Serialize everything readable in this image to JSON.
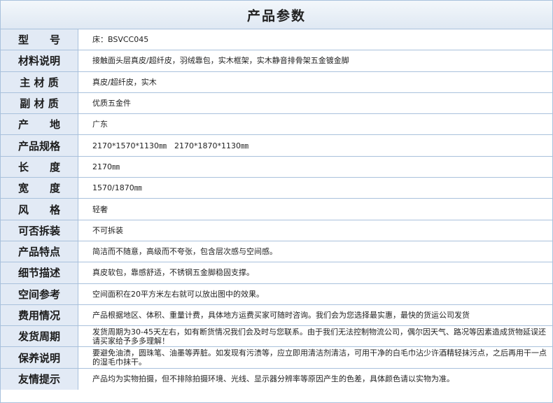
{
  "title": "产品参数",
  "rows": [
    {
      "label": "型　　号",
      "value": "床：BSVCC045"
    },
    {
      "label": "材料说明",
      "value": "接触面头层真皮/超纤皮，羽绒靠包，实木框架，实木静音排骨架五金镀金脚"
    },
    {
      "label": "主 材 质",
      "value": "真皮/超纤皮，实木"
    },
    {
      "label": "副 材 质",
      "value": "优质五金件"
    },
    {
      "label": "产　　地",
      "value": "广东"
    },
    {
      "label": "产品规格",
      "value": "2170*1570*1130㎜　2170*1870*1130㎜"
    },
    {
      "label": "长　　度",
      "value": "2170㎜"
    },
    {
      "label": "宽　　度",
      "value": "1570/1870㎜"
    },
    {
      "label": "风　　格",
      "value": "轻奢"
    },
    {
      "label": "可否拆装",
      "value": "不可拆装"
    },
    {
      "label": "产品特点",
      "value": "简洁而不随意，高级而不夸张，包含层次感与空间感。"
    },
    {
      "label": "细节描述",
      "value": "真皮软包，靠感舒适，不锈钢五金脚稳固支撑。"
    },
    {
      "label": "空间参考",
      "value": "空间面积在20平方米左右就可以放出图中的效果。"
    },
    {
      "label": "费用情况",
      "value": "产品根据地区、体积、重量计费，具体地方运费买家可随时咨询。我们会为您选择最实惠，最快的货运公司发货"
    },
    {
      "label": "发货周期",
      "value": "发货周期为30-45天左右，如有断货情况我们会及时与您联系。由于我们无法控制物流公司，偶尔因天气、路况等因素造成货物延误还请买家给予多多理解！"
    },
    {
      "label": "保养说明",
      "value": "要避免油渍，圆珠笔、油墨等弄脏。如发现有污渍等，应立即用清洁剂清洁，可用干净的白毛巾沾少许酒精轻抹污点，之后再用干一点的湿毛巾抹干。"
    },
    {
      "label": "友情提示",
      "value": "产品均为实物拍摄，但不排除拍摄环境、光线、显示器分辨率等原因产生的色差，具体颜色请以实物为准。"
    }
  ]
}
